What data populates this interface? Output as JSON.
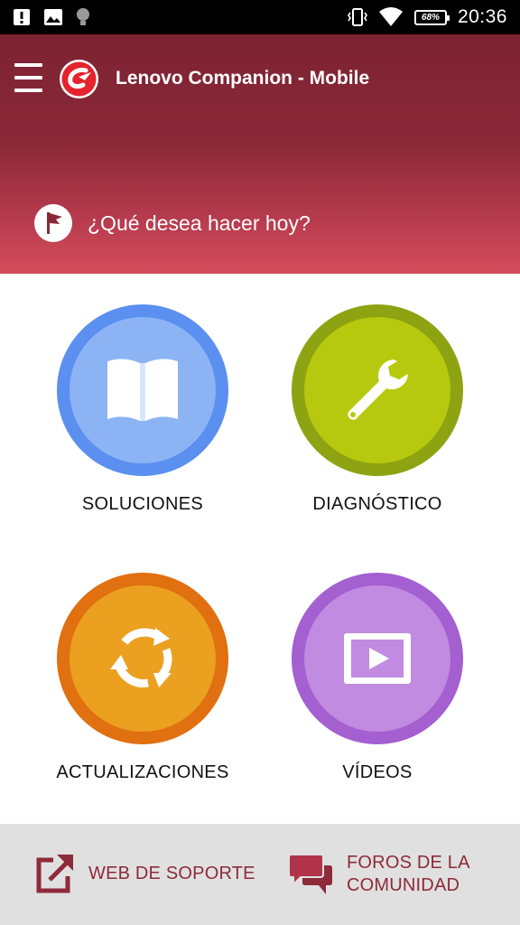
{
  "status_bar": {
    "left_icons": [
      "alert-icon",
      "image-icon",
      "lightbulb-icon"
    ],
    "right_icons": [
      "vibrate-icon",
      "wifi-icon",
      "battery-icon"
    ],
    "battery": "68%",
    "time": "20:36"
  },
  "app_bar": {
    "title": "Lenovo Companion - Mobile",
    "menu_icon": "hamburger-menu-icon",
    "logo_icon": "lenovo-companion-logo"
  },
  "prompt": {
    "icon": "flag-icon",
    "text": "¿Qué desea hacer hoy?"
  },
  "tiles": [
    {
      "label": "SOLUCIONES",
      "icon": "book-icon",
      "ring_color": "#5b8ff0",
      "fill_color": "#8cb4f5"
    },
    {
      "label": "DIAGNÓSTICO",
      "icon": "wrench-icon",
      "ring_color": "#8ea312",
      "fill_color": "#b7c90e"
    },
    {
      "label": "ACTUALIZACIONES",
      "icon": "refresh-icon",
      "ring_color": "#e07010",
      "fill_color": "#eba020"
    },
    {
      "label": "VÍDEOS",
      "icon": "play-video-icon",
      "ring_color": "#a45fd0",
      "fill_color": "#c08be0"
    }
  ],
  "footer": {
    "support": {
      "label": "WEB DE SOPORTE",
      "icon": "external-link-icon"
    },
    "forums": {
      "label_line1": "FOROS DE LA",
      "label_line2": "COMUNIDAD",
      "icon": "chat-bubbles-icon"
    }
  },
  "colors": {
    "header_top": "#7d2332",
    "header_bottom": "#d44c5c",
    "footer_bg": "#e0e0e0",
    "footer_accent": "#8e2a3a"
  }
}
